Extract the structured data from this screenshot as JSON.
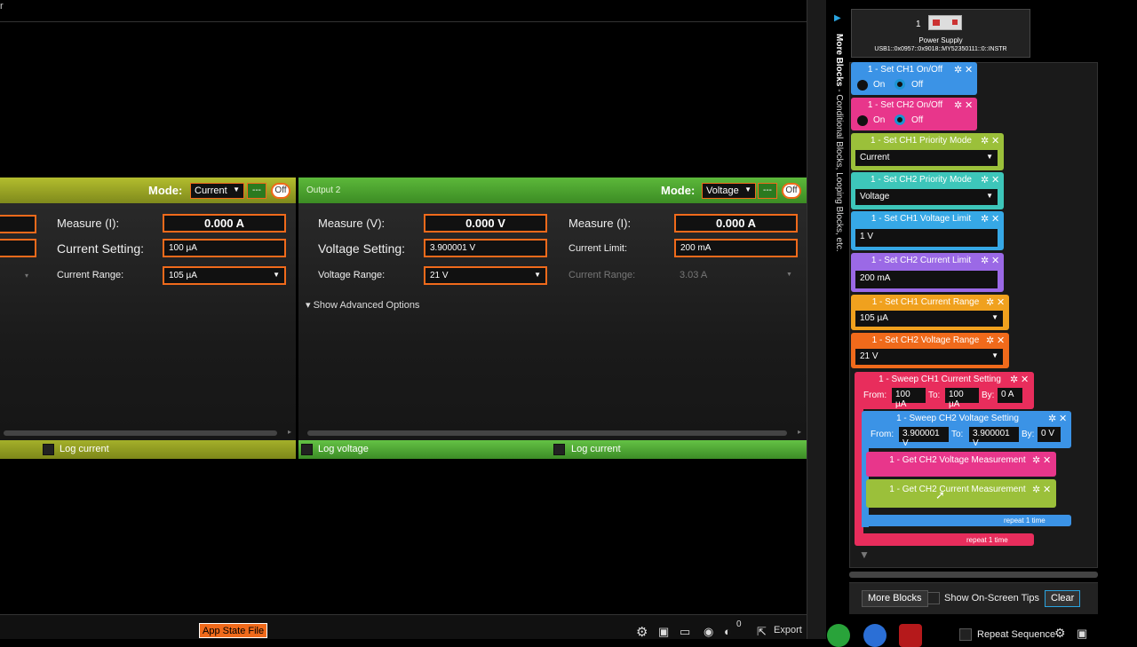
{
  "topbar": {
    "char": "r"
  },
  "panel1": {
    "mode_label": "Mode:",
    "mode_value": "Current",
    "dash": "---",
    "off": "Off",
    "measure_label": "Measure (I):",
    "measure_value": "0.000 A",
    "setting_label": "Current Setting:",
    "setting_value": "100 µA",
    "range_label": "Current Range:",
    "range_value": "105 µA",
    "log_label": "Log current"
  },
  "panel2": {
    "title": "Output 2",
    "mode_label": "Mode:",
    "mode_value": "Voltage",
    "dash": "---",
    "off": "Off",
    "measure_v_label": "Measure (V):",
    "measure_v_value": "0.000 V",
    "measure_i_label": "Measure (I):",
    "measure_i_value": "0.000 A",
    "voltage_setting_label": "Voltage Setting:",
    "voltage_setting_value": "3.900001 V",
    "current_limit_label": "Current Limit:",
    "current_limit_value": "200 mA",
    "voltage_range_label": "Voltage Range:",
    "voltage_range_value": "21 V",
    "current_range_label": "Current Range:",
    "current_range_value": "3.03 A",
    "advanced": "Show Advanced Options",
    "log_voltage": "Log voltage",
    "log_current": "Log current"
  },
  "bottombar": {
    "app_state": "App State File",
    "export": "Export",
    "badge": "0"
  },
  "rightpanel": {
    "vertical_text_bold": "More Blocks",
    "vertical_text": " - Conditional Blocks, Looping Blocks, etc.",
    "device_num": "1",
    "device_name": "Power Supply",
    "device_addr": "USB1::0x0957::0x9018::MY52350111::0::INSTR",
    "more_blocks": "More Blocks",
    "tips": "Show On-Screen Tips",
    "clear": "Clear",
    "repeat_seq": "Repeat Sequence"
  },
  "blocks": {
    "b1": {
      "title": "1 - Set CH1 On/Off",
      "on": "On",
      "off": "Off",
      "color": "#3b93e6"
    },
    "b2": {
      "title": "1 - Set CH2 On/Off",
      "on": "On",
      "off": "Off",
      "color": "#e8368b"
    },
    "b3": {
      "title": "1 - Set CH1 Priority Mode",
      "value": "Current",
      "color": "#9bc03a"
    },
    "b4": {
      "title": "1 - Set CH2 Priority Mode",
      "value": "Voltage",
      "color": "#3dc6ba"
    },
    "b5": {
      "title": "1 - Set CH1 Voltage Limit",
      "value": "1 V",
      "color": "#36a8e6"
    },
    "b6": {
      "title": "1 - Set CH2 Current Limit",
      "value": "200 mA",
      "color": "#9b69e6"
    },
    "b7": {
      "title": "1 - Set CH1 Current Range",
      "value": "105 µA",
      "color": "#f0a11e"
    },
    "b8": {
      "title": "1 - Set CH2 Voltage Range",
      "value": "21 V",
      "color": "#f06a1b"
    },
    "b9": {
      "title": "1 - Sweep CH1 Current Setting",
      "from_l": "From:",
      "from": "100 µA",
      "to_l": "To:",
      "to": "100 µA",
      "by_l": "By:",
      "by": "0 A",
      "repeat": "repeat 1 time",
      "color": "#e82d5c"
    },
    "b10": {
      "title": "1 - Sweep CH2 Voltage Setting",
      "from_l": "From:",
      "from": "3.900001 V",
      "to_l": "To:",
      "to": "3.900001 V",
      "by_l": "By:",
      "by": "0 V",
      "repeat": "repeat 1 time",
      "color": "#3b93e6"
    },
    "b11": {
      "title": "1 - Get CH2 Voltage Measurement",
      "color": "#e8368b"
    },
    "b12": {
      "title": "1 - Get CH2 Current Measurement",
      "color": "#9bc03a"
    }
  }
}
